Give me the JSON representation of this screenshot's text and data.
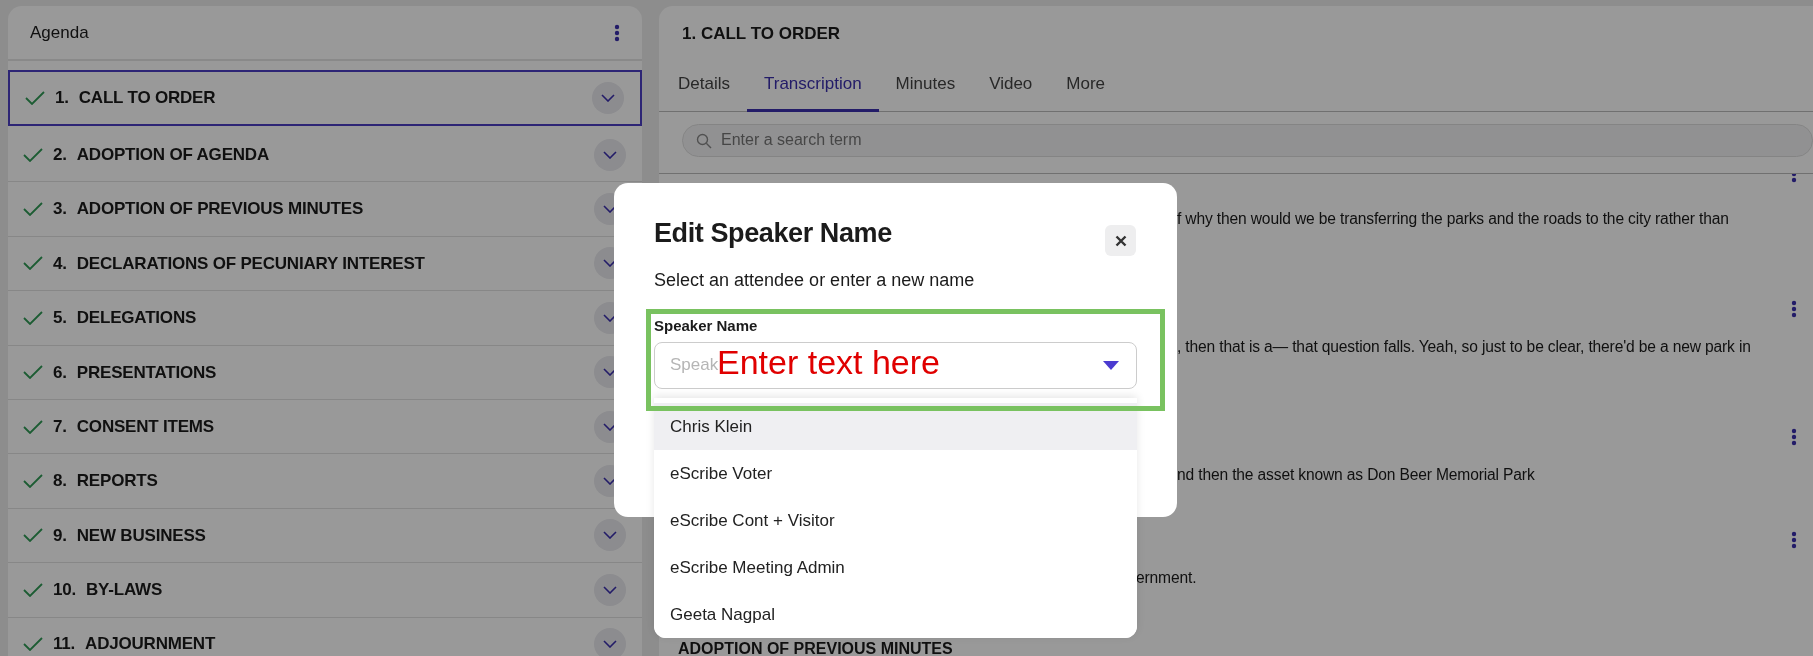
{
  "agenda": {
    "title": "Agenda",
    "items": [
      {
        "number": "1.",
        "title": "CALL TO ORDER",
        "done": true,
        "selected": true
      },
      {
        "number": "2.",
        "title": "ADOPTION OF AGENDA",
        "done": true,
        "selected": false
      },
      {
        "number": "3.",
        "title": "ADOPTION OF PREVIOUS MINUTES",
        "done": true,
        "selected": false
      },
      {
        "number": "4.",
        "title": "DECLARATIONS OF PECUNIARY INTEREST",
        "done": true,
        "selected": false
      },
      {
        "number": "5.",
        "title": "DELEGATIONS",
        "done": true,
        "selected": false
      },
      {
        "number": "6.",
        "title": "PRESENTATIONS",
        "done": true,
        "selected": false
      },
      {
        "number": "7.",
        "title": "CONSENT ITEMS",
        "done": true,
        "selected": false
      },
      {
        "number": "8.",
        "title": "REPORTS",
        "done": true,
        "selected": false
      },
      {
        "number": "9.",
        "title": "NEW BUSINESS",
        "done": true,
        "selected": false
      },
      {
        "number": "10.",
        "title": "BY-LAWS",
        "done": true,
        "selected": false
      },
      {
        "number": "11.",
        "title": "ADJOURNMENT",
        "done": true,
        "selected": false
      }
    ]
  },
  "detail": {
    "title": "1. CALL TO ORDER",
    "tabs": [
      {
        "label": "Details",
        "selected": false
      },
      {
        "label": "Transcription",
        "selected": true
      },
      {
        "label": "Minutes",
        "selected": false
      },
      {
        "label": "Video",
        "selected": false
      },
      {
        "label": "More",
        "selected": false
      }
    ],
    "search": {
      "placeholder": "Enter a search term"
    },
    "transcript": [
      {
        "text": "f why then would we be transferring the parks and the roads to the city rather than"
      },
      {
        "text": ", then that is a— that question falls. Yeah, so just to be clear, there'd be a new park in"
      },
      {
        "text": "nd then the asset known as Don Beer Memorial Park"
      },
      {
        "text": "ernment."
      }
    ],
    "next_heading": "ADOPTION OF PREVIOUS MINUTES"
  },
  "dialog": {
    "title": "Edit Speaker Name",
    "subtitle": "Select an attendee or enter a new name",
    "field_label": "Speaker Name",
    "placeholder": "Speak",
    "options": [
      {
        "label": "Chris Klein",
        "selected": true
      },
      {
        "label": "eScribe Voter",
        "selected": false
      },
      {
        "label": "eScribe Cont + Visitor",
        "selected": false
      },
      {
        "label": "eScribe Meeting Admin",
        "selected": false
      },
      {
        "label": "Geeta Nagpal",
        "selected": false
      }
    ]
  },
  "annotation": {
    "text": "Enter text here"
  }
}
